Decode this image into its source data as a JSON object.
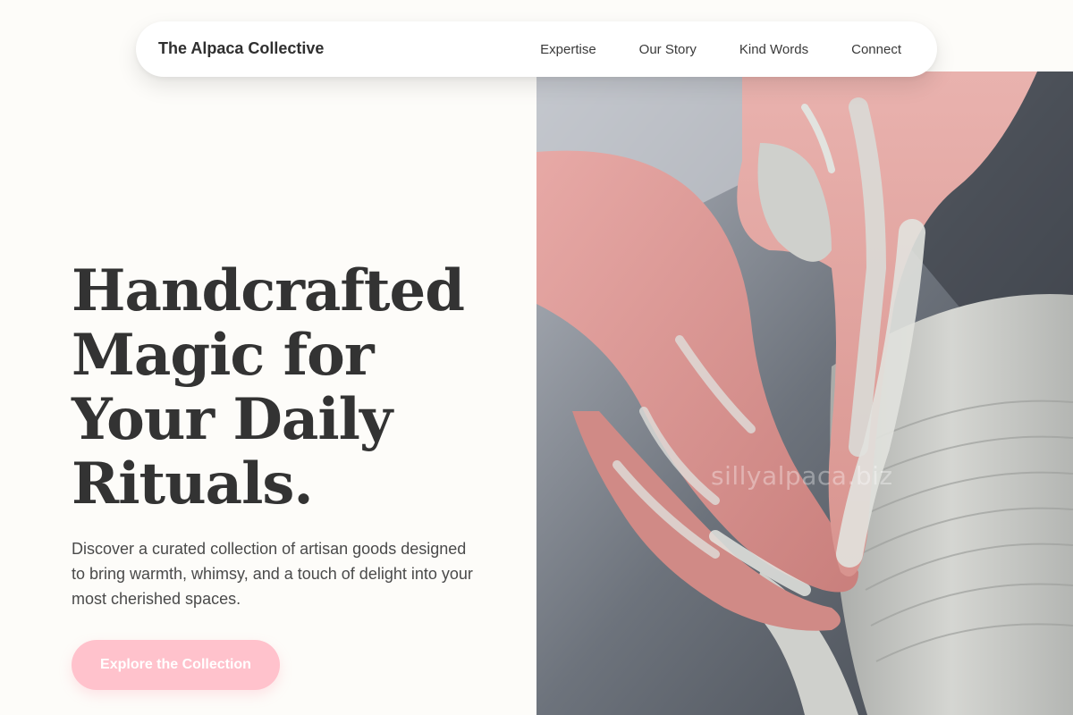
{
  "nav": {
    "brand": "The Alpaca Collective",
    "links": [
      {
        "label": "Expertise"
      },
      {
        "label": "Our Story"
      },
      {
        "label": "Kind Words"
      },
      {
        "label": "Connect"
      }
    ]
  },
  "hero": {
    "headline_lines": [
      "Handcrafted",
      "Magic for",
      "Your Daily",
      "Rituals."
    ],
    "subtext": "Discover a curated collection of artisan goods designed to bring warmth, whimsy, and a touch of delight into your most cherished spaces.",
    "cta_label": "Explore the Collection",
    "image_watermark": "sillyalpaca.biz"
  },
  "colors": {
    "background": "#fdfcf9",
    "text": "#333333",
    "cta": "#ffc2cc",
    "nav_bg": "#ffffff"
  }
}
